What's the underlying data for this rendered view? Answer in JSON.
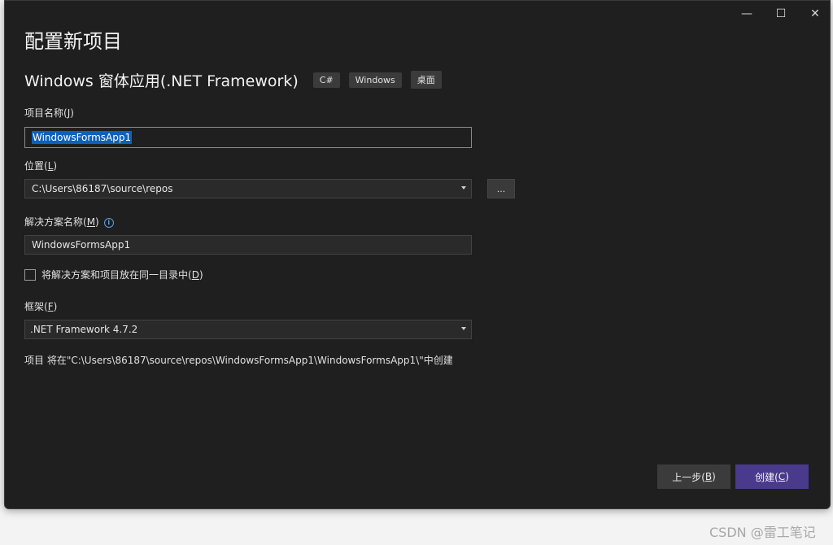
{
  "window": {
    "caption_buttons": {
      "minimize": "—",
      "maximize": "☐",
      "close": "✕"
    }
  },
  "page": {
    "title": "配置新项目",
    "template_name": "Windows 窗体应用(.NET Framework)",
    "tags": [
      "C#",
      "Windows",
      "桌面"
    ]
  },
  "form": {
    "project_name": {
      "label": "项目名称(",
      "hotkey": "J",
      "label_end": ")",
      "value": "WindowsFormsApp1"
    },
    "location": {
      "label": "位置(",
      "hotkey": "L",
      "label_end": ")",
      "value": "C:\\Users\\86187\\source\\repos",
      "browse_label": "..."
    },
    "solution_name": {
      "label": "解决方案名称(",
      "hotkey": "M",
      "label_end": ")",
      "info_glyph": "i",
      "value": "WindowsFormsApp1"
    },
    "same_directory": {
      "label": "将解决方案和项目放在同一目录中(",
      "hotkey": "D",
      "label_end": ")",
      "checked": false
    },
    "framework": {
      "label": "框架(",
      "hotkey": "F",
      "label_end": ")",
      "value": ".NET Framework 4.7.2"
    },
    "path_note": "项目 将在\"C:\\Users\\86187\\source\\repos\\WindowsFormsApp1\\WindowsFormsApp1\\\"中创建"
  },
  "footer": {
    "back": {
      "label": "上一步(",
      "hotkey": "B",
      "label_end": ")"
    },
    "create": {
      "label": "创建(",
      "hotkey": "C",
      "label_end": ")"
    }
  },
  "watermark": "CSDN @雷工笔记",
  "colors": {
    "window_bg": "#1f1f1f",
    "accent_create": "#4a3a8c",
    "selection": "#0e61b8",
    "info": "#5aa0e6"
  }
}
